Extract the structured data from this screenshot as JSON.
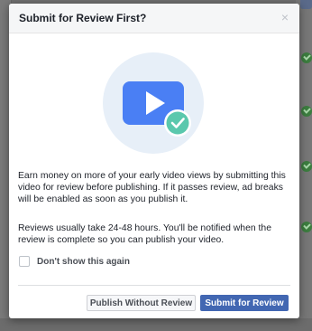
{
  "dialog": {
    "title": "Submit for Review First?",
    "close_symbol": "×",
    "paragraph_1": "Earn money on more of your early video views by submitting this video for review before publishing. If it passes review, ad breaks will be enabled as soon as you publish it.",
    "paragraph_2": "Reviews usually take 24-48 hours. You'll be notified when the review is complete so you can publish your video.",
    "checkbox_label": "Don't show this again",
    "checkbox_checked": false,
    "secondary_button": "Publish Without Review",
    "primary_button": "Submit for Review"
  },
  "illustration": {
    "icon": "video-play-icon",
    "badge_icon": "checkmark-icon"
  },
  "colors": {
    "primary": "#4267b2",
    "illustration_circle": "#e7eff8",
    "video_blue": "#4a7ff4",
    "badge_green": "#5ac8ad",
    "background_check_green": "#3c7d3f"
  }
}
